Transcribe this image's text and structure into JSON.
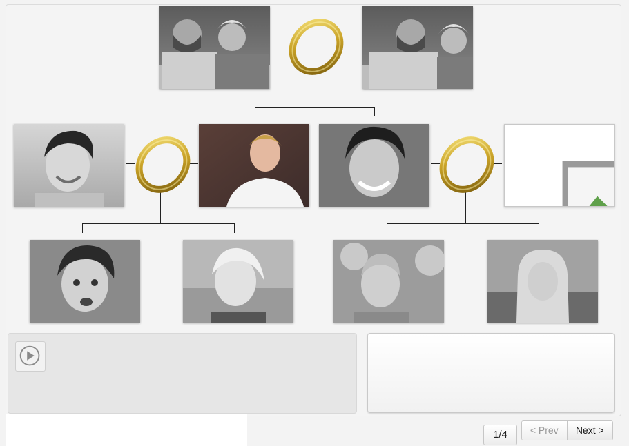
{
  "family_tree": {
    "generation_1": [
      {
        "id": "grandparents-left",
        "kind": "couple-photo"
      },
      {
        "id": "grandparents-right",
        "kind": "couple-photo"
      }
    ],
    "generation_2": [
      {
        "id": "spouse-left",
        "kind": "portrait"
      },
      {
        "id": "child-1",
        "kind": "portrait"
      },
      {
        "id": "child-2",
        "kind": "portrait"
      },
      {
        "id": "spouse-right",
        "kind": "missing-image"
      }
    ],
    "generation_3": [
      {
        "id": "grandchild-1",
        "kind": "portrait"
      },
      {
        "id": "grandchild-2",
        "kind": "portrait"
      },
      {
        "id": "grandchild-3",
        "kind": "portrait"
      },
      {
        "id": "grandchild-4",
        "kind": "portrait"
      }
    ],
    "marriage_icon": "gold-ring-icon"
  },
  "player": {
    "play_icon": "play-icon"
  },
  "pagination": {
    "page_indicator": "1/4",
    "prev_label": "< Prev",
    "next_label": "Next >"
  },
  "colors": {
    "ring_gold": "#c9a227",
    "panel_bg": "#f4f4f4",
    "connector": "#222222"
  }
}
